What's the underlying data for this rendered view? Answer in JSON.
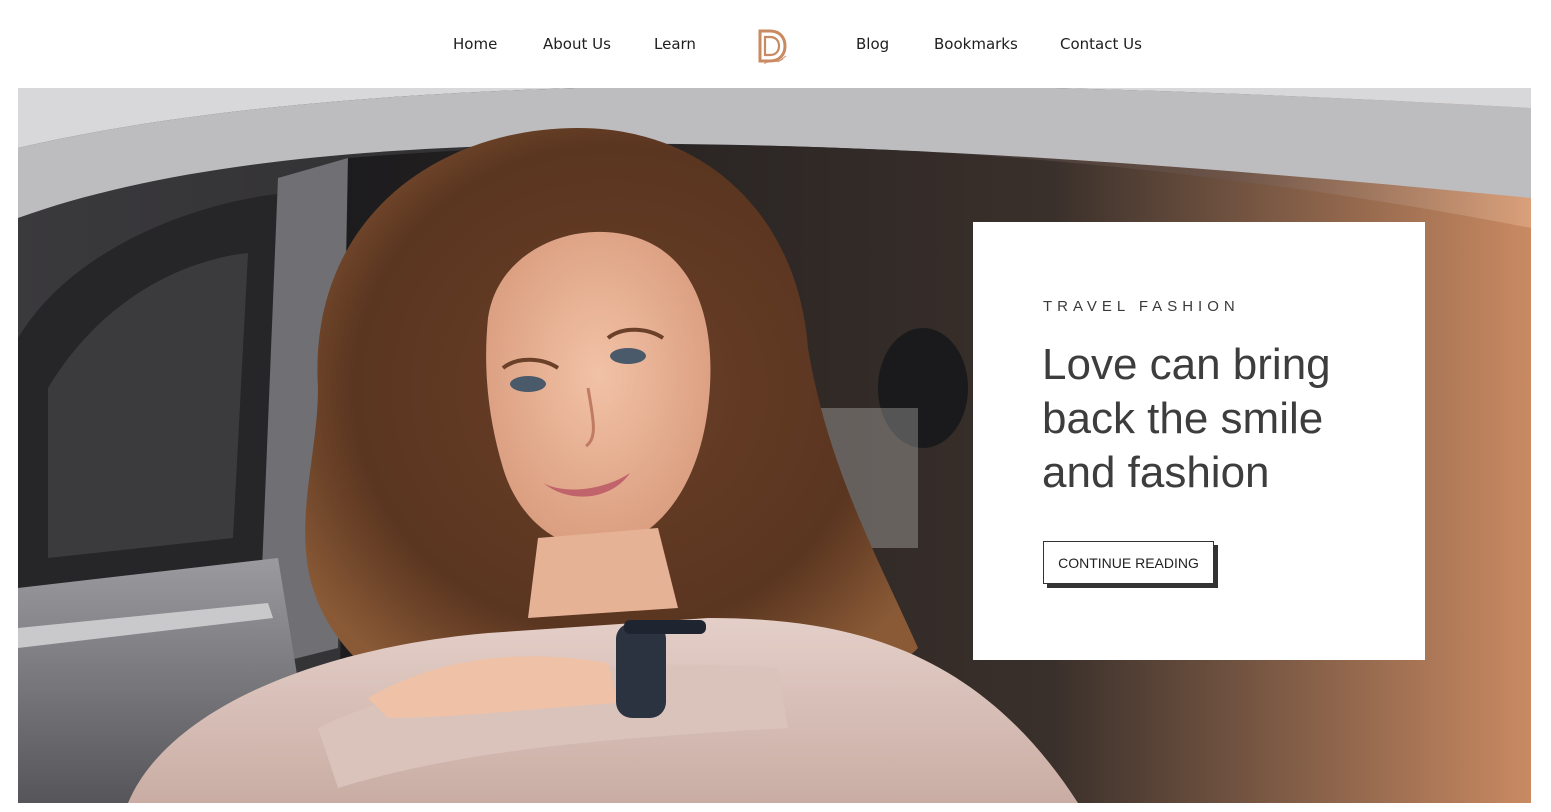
{
  "nav": {
    "left_links": [
      "Home",
      "About Us",
      "Learn"
    ],
    "right_links": [
      "Blog",
      "Bookmarks",
      "Contact Us"
    ],
    "logo_icon": "d-monogram-logo",
    "logo_color": "#c98a62"
  },
  "hero": {
    "eyebrow": "TRAVEL FASHION",
    "headline": "Love can bring back the smile and fashion",
    "button_label": "CONTINUE READING"
  },
  "colors": {
    "text_dark": "#3d3d3d",
    "card_bg": "#ffffff",
    "accent": "#c98a62"
  }
}
